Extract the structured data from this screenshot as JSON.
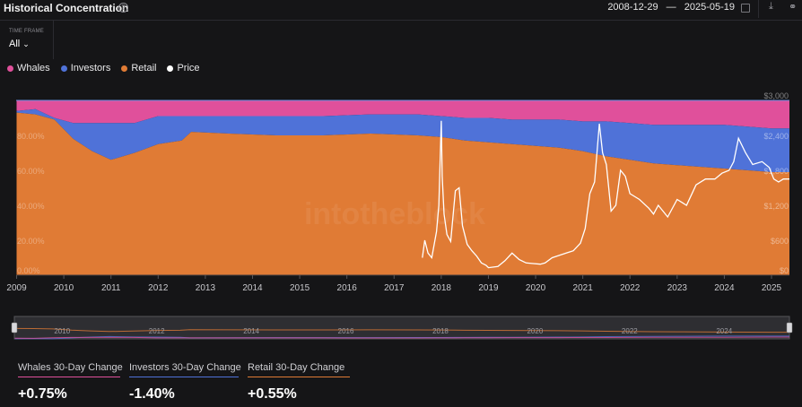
{
  "header": {
    "title": "Historical Concentration",
    "help_glyph": "?",
    "date_from": "2008-12-29",
    "date_sep": "—",
    "date_to": "2025-05-19",
    "icons": [
      "calendar-icon",
      "download-icon",
      "share-icon"
    ]
  },
  "timeframe": {
    "label": "TIME FRAME",
    "value": "All",
    "chevron": "⌄"
  },
  "legend": [
    {
      "name": "Whales",
      "color": "#e0509b"
    },
    {
      "name": "Investors",
      "color": "#4f72d8"
    },
    {
      "name": "Retail",
      "color": "#e07b35"
    },
    {
      "name": "Price",
      "color": "#ffffff"
    }
  ],
  "watermark": "intotheblock",
  "chart_data": {
    "type": "area",
    "stacked": true,
    "percent_axis": {
      "ticks": [
        "0.00%",
        "20.00%",
        "40.00%",
        "60.00%",
        "80.00%"
      ],
      "range": [
        0,
        100
      ]
    },
    "price_axis": {
      "ticks": [
        "$0",
        "$600",
        "$1,200",
        "$1,800",
        "$2,400",
        "$3,000"
      ],
      "range": [
        0,
        3000
      ]
    },
    "x_ticks": [
      "2009",
      "2010",
      "2011",
      "2012",
      "2013",
      "2014",
      "2015",
      "2016",
      "2017",
      "2018",
      "2019",
      "2020",
      "2021",
      "2022",
      "2023",
      "2024",
      "2025"
    ],
    "x_range": [
      2008.99,
      2025.38
    ],
    "series": [
      {
        "name": "Retail",
        "color": "#e07b35",
        "x": [
          2009.0,
          2009.4,
          2009.8,
          2010.2,
          2010.6,
          2011.0,
          2011.5,
          2012.0,
          2012.5,
          2012.7,
          2013.5,
          2014.5,
          2015.5,
          2016.5,
          2017.5,
          2018.0,
          2018.5,
          2019.0,
          2019.5,
          2020.0,
          2020.5,
          2021.0,
          2021.5,
          2022.0,
          2022.5,
          2023.0,
          2023.5,
          2024.0,
          2024.5,
          2025.0,
          2025.38
        ],
        "values": [
          93,
          92,
          89,
          78,
          71,
          66,
          70,
          75,
          77,
          82,
          81,
          80,
          80,
          81,
          80,
          79,
          77,
          76,
          75,
          74,
          73,
          71,
          68,
          66,
          64,
          63,
          62,
          61,
          60,
          59,
          59
        ]
      },
      {
        "name": "Investors",
        "color": "#4f72d8",
        "x": [
          2009.0,
          2009.4,
          2009.8,
          2010.2,
          2010.6,
          2011.0,
          2011.5,
          2012.0,
          2012.5,
          2012.7,
          2013.5,
          2014.5,
          2015.5,
          2016.5,
          2017.5,
          2018.0,
          2018.5,
          2019.0,
          2019.5,
          2020.0,
          2020.5,
          2021.0,
          2021.5,
          2022.0,
          2022.5,
          2023.0,
          2023.5,
          2024.0,
          2024.5,
          2025.0,
          2025.38
        ],
        "values": [
          1,
          3,
          1,
          9,
          16,
          21,
          17,
          16,
          14,
          9,
          10,
          11,
          11,
          11,
          12,
          12,
          13,
          14,
          14,
          15,
          16,
          17,
          20,
          21,
          22,
          23,
          24,
          25,
          25,
          25,
          25
        ]
      },
      {
        "name": "Whales",
        "color": "#e0509b",
        "x": [
          2009.0,
          2009.4,
          2009.8,
          2010.2,
          2010.6,
          2011.0,
          2011.5,
          2012.0,
          2012.5,
          2012.7,
          2013.5,
          2014.5,
          2015.5,
          2016.5,
          2017.5,
          2018.0,
          2018.5,
          2019.0,
          2019.5,
          2020.0,
          2020.5,
          2021.0,
          2021.5,
          2022.0,
          2022.5,
          2023.0,
          2023.5,
          2024.0,
          2024.5,
          2025.0,
          2025.38
        ],
        "values": [
          6,
          5,
          10,
          13,
          13,
          13,
          13,
          9,
          9,
          9,
          9,
          9,
          9,
          8,
          8,
          9,
          10,
          10,
          11,
          11,
          11,
          12,
          12,
          13,
          14,
          14,
          14,
          14,
          15,
          16,
          16
        ]
      },
      {
        "name": "Price",
        "color": "#ffffff",
        "axis": "price",
        "x": [
          2017.6,
          2017.65,
          2017.72,
          2017.8,
          2017.9,
          2017.95,
          2018.0,
          2018.02,
          2018.06,
          2018.12,
          2018.2,
          2018.3,
          2018.38,
          2018.45,
          2018.55,
          2018.65,
          2018.75,
          2018.85,
          2018.95,
          2019.0,
          2019.2,
          2019.35,
          2019.5,
          2019.65,
          2019.8,
          2019.95,
          2020.1,
          2020.2,
          2020.35,
          2020.5,
          2020.65,
          2020.8,
          2020.95,
          2021.05,
          2021.15,
          2021.25,
          2021.35,
          2021.42,
          2021.5,
          2021.6,
          2021.7,
          2021.8,
          2021.9,
          2022.0,
          2022.2,
          2022.4,
          2022.5,
          2022.6,
          2022.8,
          2023.0,
          2023.2,
          2023.4,
          2023.6,
          2023.8,
          2023.95,
          2024.1,
          2024.2,
          2024.3,
          2024.45,
          2024.6,
          2024.8,
          2024.95,
          2025.05,
          2025.15,
          2025.25,
          2025.38
        ],
        "values": [
          300,
          600,
          380,
          300,
          750,
          1200,
          2650,
          1700,
          1050,
          700,
          580,
          1450,
          1500,
          850,
          530,
          420,
          330,
          210,
          170,
          130,
          150,
          250,
          380,
          270,
          210,
          200,
          190,
          210,
          300,
          340,
          380,
          420,
          550,
          800,
          1400,
          1600,
          2600,
          2100,
          1900,
          1100,
          1200,
          1800,
          1700,
          1400,
          1300,
          1150,
          1050,
          1200,
          1000,
          1300,
          1200,
          1550,
          1650,
          1650,
          1750,
          1800,
          1950,
          2350,
          2100,
          1900,
          1950,
          1850,
          1650,
          1600,
          1650,
          1650
        ]
      }
    ]
  },
  "navigator": {
    "ticks": [
      "2010",
      "2012",
      "2014",
      "2016",
      "2018",
      "2020",
      "2022",
      "2024"
    ]
  },
  "stats": [
    {
      "label": "Whales 30-Day Change",
      "value": "+0.75%",
      "color": "#e0509b"
    },
    {
      "label": "Investors 30-Day Change",
      "value": "-1.40%",
      "color": "#4f72d8"
    },
    {
      "label": "Retail 30-Day Change",
      "value": "+0.55%",
      "color": "#e07b35"
    }
  ]
}
